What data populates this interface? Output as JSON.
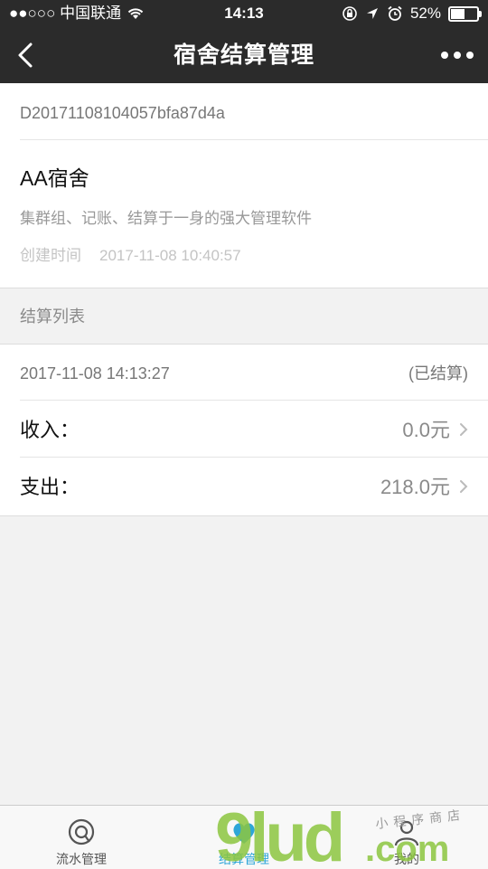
{
  "status_bar": {
    "carrier": "●●○○○ 中国联通",
    "time": "14:13",
    "battery": "52%",
    "battery_level": 0.52
  },
  "nav": {
    "title": "宿舍结算管理",
    "back_icon": "chevron-left-icon",
    "more_icon": "more-dots-icon"
  },
  "group": {
    "id": "D20171108104057bfa87d4a",
    "name": "AA宿舍",
    "description": "集群组、记账、结算于一身的强大管理软件",
    "created_label": "创建时间",
    "created_value": "2017-11-08 10:40:57"
  },
  "settlement": {
    "section_label": "结算列表",
    "date": "2017-11-08 14:13:27",
    "status": "(已结算)",
    "income_label": "收入：",
    "income_value": "0.0元",
    "expense_label": "支出：",
    "expense_value": "218.0元"
  },
  "tabbar": {
    "tabs": [
      {
        "label": "流水管理",
        "icon": "chat-circle-icon"
      },
      {
        "label": "结算管理",
        "icon": "settle-icon",
        "active": true
      },
      {
        "label": "我的",
        "icon": "user-icon"
      }
    ]
  },
  "watermark": {
    "brand": "9lud.com",
    "small": "小程序商店"
  },
  "colors": {
    "header_bg": "#2b2b2b",
    "active_tab": "#2ea6d8",
    "watermark_green": "#8cc63f"
  }
}
